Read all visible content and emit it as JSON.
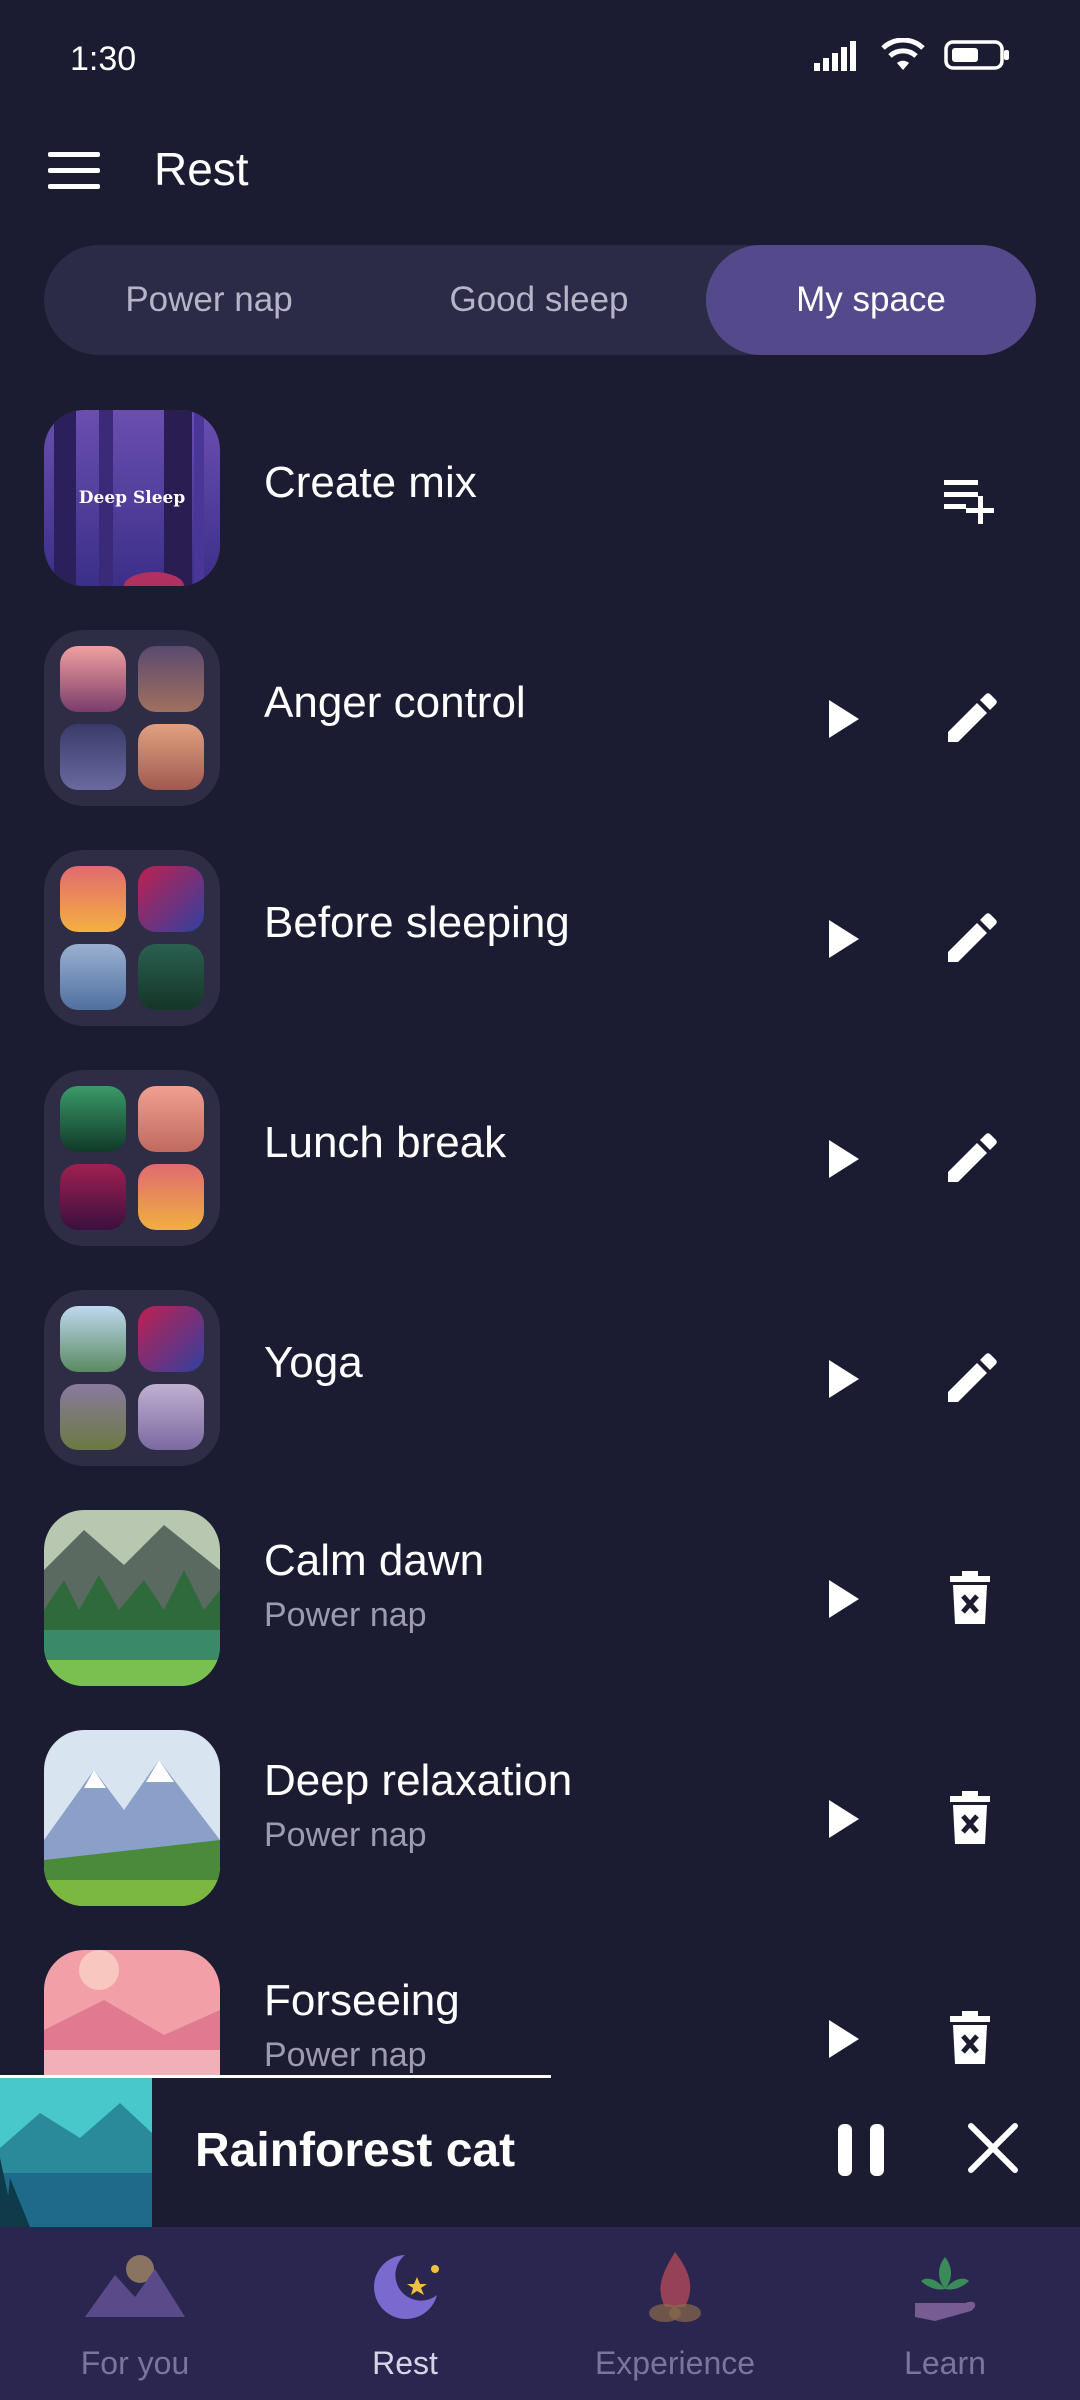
{
  "status_bar": {
    "time": "1:30"
  },
  "app_bar": {
    "title": "Rest"
  },
  "tabs": [
    {
      "label": "Power nap",
      "active": false
    },
    {
      "label": "Good sleep",
      "active": false
    },
    {
      "label": "My space",
      "active": true
    }
  ],
  "items": [
    {
      "title": "Create mix",
      "subtitle": "",
      "thumb_label": "Deep Sleep",
      "action": "playlist-add-icon"
    },
    {
      "title": "Anger control",
      "subtitle": "",
      "action": "edit-icon"
    },
    {
      "title": "Before sleeping",
      "subtitle": "",
      "action": "edit-icon"
    },
    {
      "title": "Lunch break",
      "subtitle": "",
      "action": "edit-icon"
    },
    {
      "title": "Yoga",
      "subtitle": "",
      "action": "edit-icon"
    },
    {
      "title": "Calm dawn",
      "subtitle": "Power nap",
      "action": "delete-icon"
    },
    {
      "title": "Deep relaxation",
      "subtitle": "Power nap",
      "action": "delete-icon"
    },
    {
      "title": "Forseeing",
      "subtitle": "Power nap",
      "action": "delete-icon"
    }
  ],
  "player": {
    "title": "Rainforest cat",
    "progress": 0.51
  },
  "nav": [
    {
      "label": "For you",
      "active": false
    },
    {
      "label": "Rest",
      "active": true
    },
    {
      "label": "Experience",
      "active": false
    },
    {
      "label": "Learn",
      "active": false
    }
  ],
  "colors": {
    "background": "#1b1b31",
    "segment_bg": "#2c2b47",
    "segment_active": "#544a8b",
    "nav_bg": "#2a2650",
    "subtitle": "#9c9bb0"
  }
}
